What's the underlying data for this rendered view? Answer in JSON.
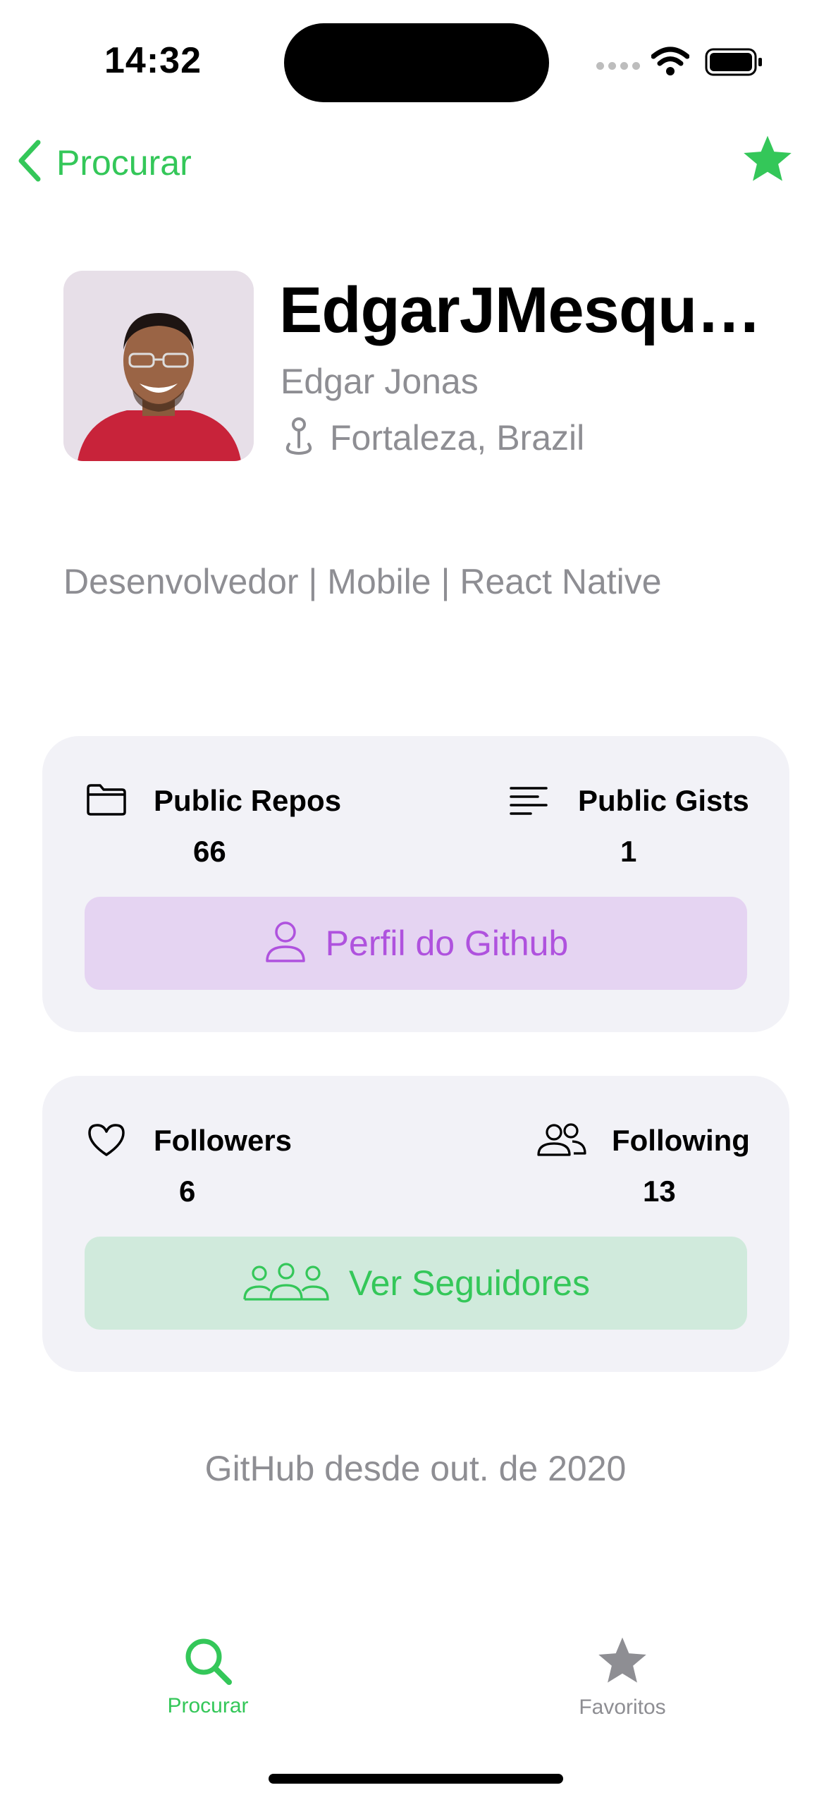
{
  "status_bar": {
    "time": "14:32"
  },
  "nav": {
    "back_label": "Procurar",
    "favorite_icon": "star-icon"
  },
  "profile": {
    "username": "EdgarJMesqui…",
    "name": "Edgar Jonas",
    "location": "Fortaleza, Brazil",
    "bio": "Desenvolvedor | Mobile | React Native"
  },
  "repos_card": {
    "repos_label": "Public Repos",
    "repos_value": "66",
    "gists_label": "Public Gists",
    "gists_value": "1",
    "button_label": "Perfil do Github"
  },
  "followers_card": {
    "followers_label": "Followers",
    "followers_value": "6",
    "following_label": "Following",
    "following_value": "13",
    "button_label": "Ver Seguidores"
  },
  "footer": {
    "since": "GitHub desde out. de 2020"
  },
  "tab_bar": {
    "items": [
      {
        "label": "Procurar",
        "icon": "search-icon",
        "active": true
      },
      {
        "label": "Favoritos",
        "icon": "star-icon",
        "active": false
      }
    ]
  },
  "colors": {
    "accent_green": "#34c759",
    "purple": "#af52de",
    "purple_bg": "#e5d4f2",
    "green_bg": "#d0eadc",
    "secondary_text": "#8e8e93",
    "card_bg": "#f2f2f7",
    "inactive_tab": "#8e8e93"
  }
}
